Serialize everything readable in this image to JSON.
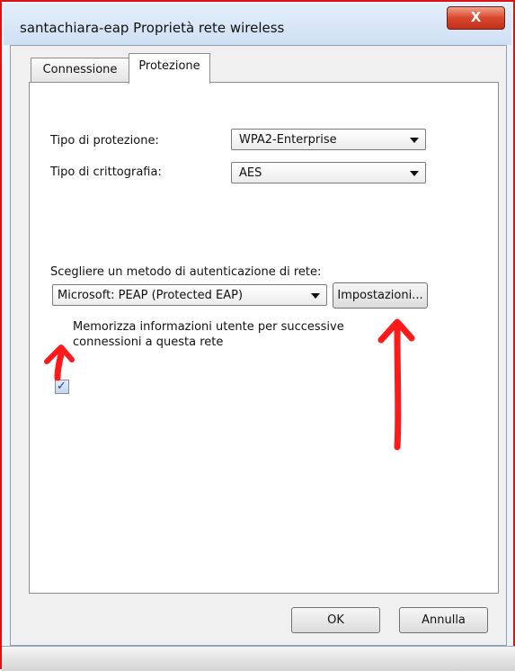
{
  "window": {
    "title": "santachiara-eap Proprietà rete wireless",
    "close_glyph": "X"
  },
  "tabs": [
    {
      "label": "Connessione",
      "selected": false
    },
    {
      "label": "Protezione",
      "selected": true
    }
  ],
  "security": {
    "type_label": "Tipo di protezione:",
    "type_value": "WPA2-Enterprise",
    "encryption_label": "Tipo di crittografia:",
    "encryption_value": "AES"
  },
  "auth": {
    "prompt": "Scegliere un metodo di autenticazione di rete:",
    "method_value": "Microsoft: PEAP (Protected EAP)",
    "settings_button": "Impostazioni...",
    "remember_checked": true,
    "remember_line1": "Memorizza informazioni utente per successive",
    "remember_line2": "connessioni a questa rete"
  },
  "footer": {
    "ok_label": "OK",
    "cancel_label": "Annulla"
  },
  "colors": {
    "annotation_red": "#ff1a1a",
    "close_button": "#c9402a",
    "window_frame": "#d61616"
  }
}
